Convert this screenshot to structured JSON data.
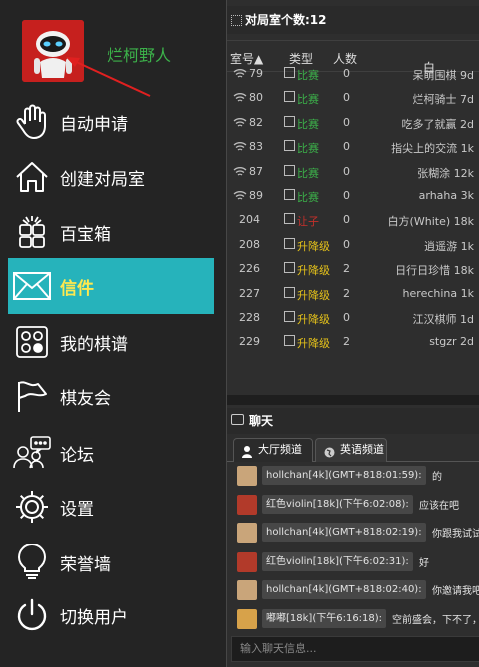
{
  "user": {
    "name": "烂柯野人"
  },
  "nav": [
    {
      "label": "自动申请",
      "icon": "hand-icon"
    },
    {
      "label": "创建对局室",
      "icon": "home-icon"
    },
    {
      "label": "百宝箱",
      "icon": "treasure-box-icon"
    },
    {
      "label": "信件",
      "icon": "mail-icon"
    },
    {
      "label": "我的棋谱",
      "icon": "board-icon"
    },
    {
      "label": "棋友会",
      "icon": "flag-icon"
    },
    {
      "label": "论坛",
      "icon": "forum-icon"
    },
    {
      "label": "设置",
      "icon": "gear-icon"
    },
    {
      "label": "荣誉墙",
      "icon": "bulb-icon"
    },
    {
      "label": "切换用户",
      "icon": "power-icon"
    }
  ],
  "rooms": {
    "title": "对局室个数:12",
    "columns": {
      "room": "室号▲",
      "type": "类型",
      "count": "人数",
      "white": "白"
    },
    "rows": [
      {
        "id": "79",
        "type": "比赛",
        "count": "0",
        "white": "呆萌围棋 9d",
        "live": true
      },
      {
        "id": "80",
        "type": "比赛",
        "count": "0",
        "white": "烂柯骑士 7d",
        "live": true
      },
      {
        "id": "82",
        "type": "比赛",
        "count": "0",
        "white": "吃多了就赢 2d",
        "live": true
      },
      {
        "id": "83",
        "type": "比赛",
        "count": "0",
        "white": "指尖上的交流 1k",
        "live": true
      },
      {
        "id": "87",
        "type": "比赛",
        "count": "0",
        "white": "张糊涂 12k",
        "live": true
      },
      {
        "id": "89",
        "type": "比赛",
        "count": "0",
        "white": "arhaha 3k",
        "live": true
      },
      {
        "id": "204",
        "type": "让子",
        "count": "0",
        "white": "白方(White) 18k",
        "live": false
      },
      {
        "id": "208",
        "type": "升降级",
        "count": "0",
        "white": "逍遥游 1k",
        "live": false
      },
      {
        "id": "226",
        "type": "升降级",
        "count": "2",
        "white": "日行日珍惜 18k",
        "live": false
      },
      {
        "id": "227",
        "type": "升降级",
        "count": "2",
        "white": "herechina 1k",
        "live": false
      },
      {
        "id": "228",
        "type": "升降级",
        "count": "0",
        "white": "江汉棋师 1d",
        "live": false
      },
      {
        "id": "229",
        "type": "升降级",
        "count": "2",
        "white": "stgzr 2d",
        "live": false
      }
    ]
  },
  "chat": {
    "title": "聊天",
    "tabs": [
      "大厅频道",
      "英语频道"
    ],
    "messages": [
      {
        "name": "hollchan[4k](GMT+818:01:59):",
        "text": "的",
        "avatar_color": "#c9a57a"
      },
      {
        "name": "红色violin[18k](下午6:02:08):",
        "text": "应该在吧",
        "avatar_color": "#b23a2a"
      },
      {
        "name": "hollchan[4k](GMT+818:02:19):",
        "text": "你跟我试试ok",
        "avatar_color": "#c9a57a"
      },
      {
        "name": "红色violin[18k](下午6:02:31):",
        "text": "好",
        "avatar_color": "#b23a2a"
      },
      {
        "name": "hollchan[4k](GMT+818:02:40):",
        "text": "你邀请我吧",
        "avatar_color": "#c9a57a"
      },
      {
        "name": "嘟嘟[18k](下午6:16:18):",
        "text": "空前盛会，下不了，东",
        "avatar_color": "#d7a24a"
      }
    ],
    "input_placeholder": "输入聊天信息..."
  },
  "colors": {
    "accent": "#26b3bb",
    "active_text": "#fde84f",
    "match": "#3cb14a",
    "promote": "#e5c21a",
    "handicap": "#c4302b"
  }
}
